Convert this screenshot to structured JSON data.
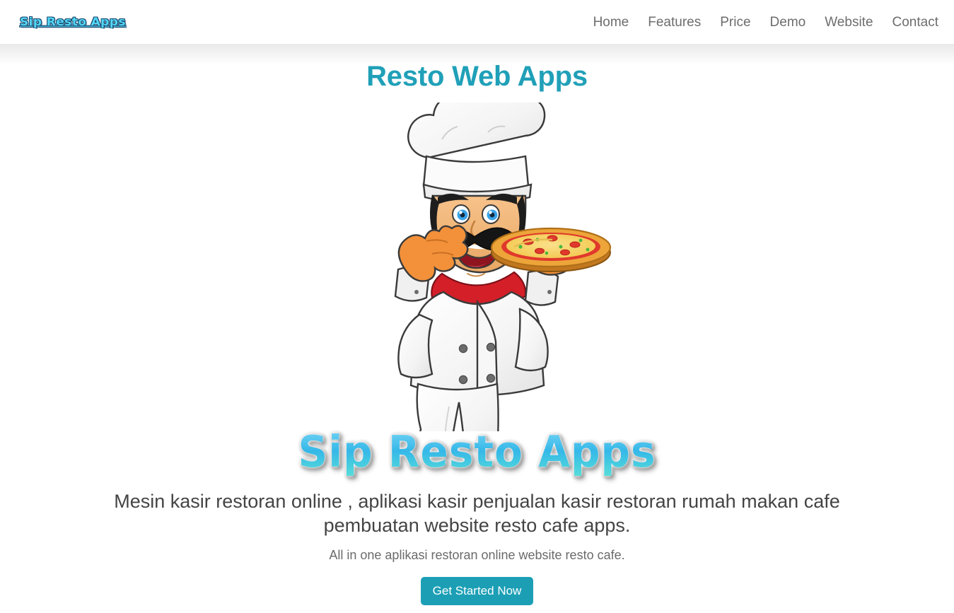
{
  "header": {
    "brand": "Sip Resto Apps",
    "nav_items": [
      {
        "label": "Home"
      },
      {
        "label": "Features"
      },
      {
        "label": "Price"
      },
      {
        "label": "Demo"
      },
      {
        "label": "Website"
      },
      {
        "label": "Contact"
      }
    ]
  },
  "hero": {
    "title": "Resto Web Apps",
    "logo_text": "Sip Resto Apps",
    "description": "Mesin kasir restoran online , aplikasi kasir penjualan kasir restoran rumah makan cafe pembuatan website resto cafe apps.",
    "subtitle": "All in one aplikasi restoran online website resto cafe.",
    "cta_label": "Get Started Now",
    "illustration_name": "chef-holding-pizza-mascot"
  },
  "colors": {
    "accent_teal": "#1c9fb5",
    "title_teal": "#20a0b8",
    "logo_cyan": "#55d6f5",
    "logo_outline": "#14486e",
    "body_text": "#444444",
    "nav_text": "#6d6d6d",
    "page_background": "#ffffff"
  }
}
